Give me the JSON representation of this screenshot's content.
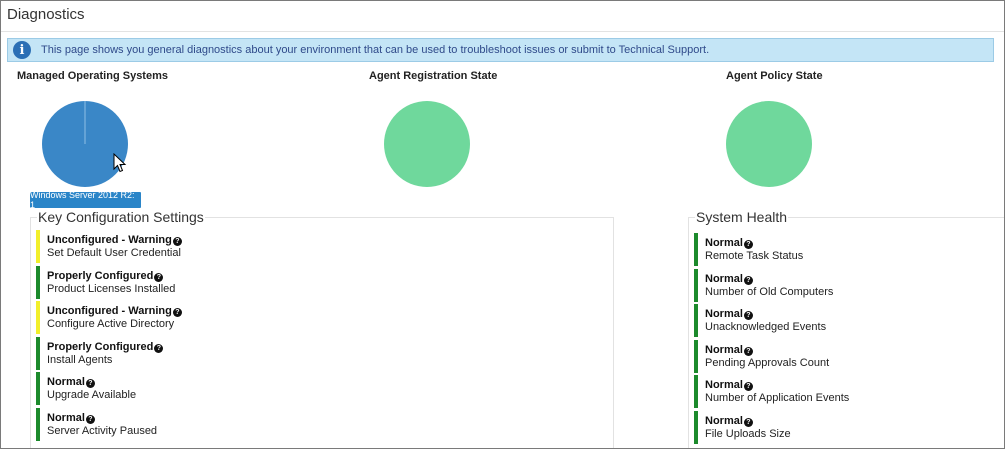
{
  "page": {
    "title": "Diagnostics"
  },
  "info_banner": {
    "icon": "info-icon",
    "text": "This page shows you general diagnostics about your environment that can be used to troubleshoot issues or submit to Technical Support."
  },
  "charts": [
    {
      "title": "Managed Operating Systems",
      "color": "#3a87c7",
      "tooltip": "Windows Server 2012 R2: 1"
    },
    {
      "title": "Agent Registration State",
      "color": "#6fd89c"
    },
    {
      "title": "Agent Policy State",
      "color": "#6fd89c"
    }
  ],
  "colors": {
    "warning": "#f2ef2b",
    "ok": "#1c8a2c"
  },
  "key_config": {
    "title": "Key Configuration Settings",
    "items": [
      {
        "status": "Unconfigured - Warning",
        "desc": "Set Default User Credential",
        "level": "warning"
      },
      {
        "status": "Properly Configured",
        "desc": "Product Licenses Installed",
        "level": "ok"
      },
      {
        "status": "Unconfigured - Warning",
        "desc": "Configure Active Directory",
        "level": "warning"
      },
      {
        "status": "Properly Configured",
        "desc": "Install Agents",
        "level": "ok"
      },
      {
        "status": "Normal",
        "desc": "Upgrade Available",
        "level": "ok"
      },
      {
        "status": "Normal",
        "desc": "Server Activity Paused",
        "level": "ok"
      }
    ]
  },
  "system_health": {
    "title": "System Health",
    "items": [
      {
        "status": "Normal",
        "desc": "Remote Task Status",
        "level": "ok"
      },
      {
        "status": "Normal",
        "desc": "Number of Old Computers",
        "level": "ok"
      },
      {
        "status": "Normal",
        "desc": "Unacknowledged Events",
        "level": "ok"
      },
      {
        "status": "Normal",
        "desc": "Pending Approvals Count",
        "level": "ok"
      },
      {
        "status": "Normal",
        "desc": "Number of Application Events",
        "level": "ok"
      },
      {
        "status": "Normal",
        "desc": "File Uploads Size",
        "level": "ok"
      }
    ]
  }
}
